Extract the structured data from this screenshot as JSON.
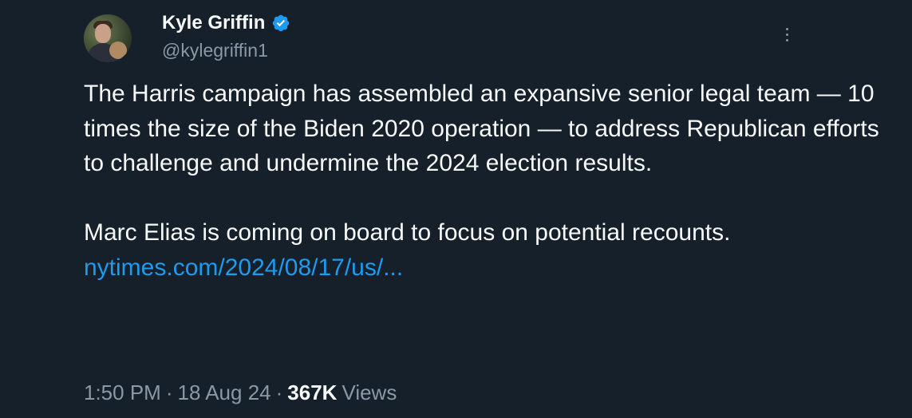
{
  "author": {
    "name": "Kyle Griffin",
    "handle": "@kylegriffin1",
    "verified": true,
    "verified_color": "#1d9bf0"
  },
  "tweet": {
    "paragraph1": "The Harris campaign has assembled an expansive senior legal team — 10 times the size of the Biden 2020 operation — to address Republican efforts to challenge and undermine the 2024 election results.",
    "paragraph2": "Marc Elias is coming on board to focus on potential recounts.",
    "link_text": "nytimes.com/2024/08/17/us/..."
  },
  "meta": {
    "time": "1:50 PM",
    "separator": "·",
    "date": "18 Aug 24",
    "views_count": "367K",
    "views_label": "Views"
  },
  "colors": {
    "background": "#15202b",
    "text": "#f7f9f9",
    "secondary": "#8b98a5",
    "link": "#1d9bf0"
  }
}
